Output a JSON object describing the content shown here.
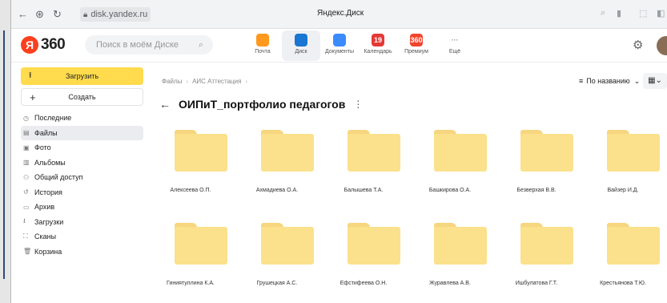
{
  "browser": {
    "url": "disk.yandex.ru",
    "window_title": "Яндекс.Диск"
  },
  "header": {
    "logo_letter": "Я",
    "logo_number": "360",
    "search_placeholder": "Поиск в моём Диске",
    "services": [
      {
        "label": "Почта",
        "color": "#ff9a1f",
        "active": false
      },
      {
        "label": "Диск",
        "color": "#1976d2",
        "active": true
      },
      {
        "label": "Документы",
        "color": "#3b8bff",
        "active": false
      },
      {
        "label": "Календарь",
        "color": "#e53935",
        "badge": "19",
        "active": false
      },
      {
        "label": "Премиум",
        "color": "#f2452d",
        "badge": "360",
        "active": false
      },
      {
        "label": "Ещё",
        "color": "#ffffff",
        "active": false
      }
    ]
  },
  "sidebar": {
    "upload_label": "Загрузить",
    "create_label": "Создать",
    "items": [
      {
        "label": "Последние",
        "icon": "clock-icon",
        "active": false
      },
      {
        "label": "Файлы",
        "icon": "file-icon",
        "active": true
      },
      {
        "label": "Фото",
        "icon": "photo-icon",
        "active": false
      },
      {
        "label": "Альбомы",
        "icon": "album-icon",
        "active": false
      },
      {
        "label": "Общий доступ",
        "icon": "shared-icon",
        "active": false
      },
      {
        "label": "История",
        "icon": "history-icon",
        "active": false
      },
      {
        "label": "Архив",
        "icon": "archive-icon",
        "active": false
      },
      {
        "label": "Загрузки",
        "icon": "download-icon",
        "active": false
      },
      {
        "label": "Сканы",
        "icon": "scan-icon",
        "active": false
      },
      {
        "label": "Корзина",
        "icon": "trash-icon",
        "active": false
      }
    ]
  },
  "main": {
    "breadcrumbs": [
      "Файлы",
      "АИС Аттестация"
    ],
    "sort_label": "По названию",
    "folder_title": "ОИПиТ_портфолио педагогов",
    "folders": [
      "Алексеева О.П.",
      "Ахмадиева О.А.",
      "Балышева Т.А.",
      "Башкирова О.А.",
      "Безверхая В.В.",
      "Вайзер И.Д.",
      "Гиниятуллина К.А.",
      "Грушецкая А.С.",
      "Ефстифеева О.Н.",
      "Журавлева А.В.",
      "Ишбулатова Г.Т.",
      "Крестьянова Т.Ю."
    ]
  },
  "colors": {
    "accent": "#ffdb4d",
    "folder": "#fbe18c",
    "folder_tab": "#f6d67f"
  }
}
